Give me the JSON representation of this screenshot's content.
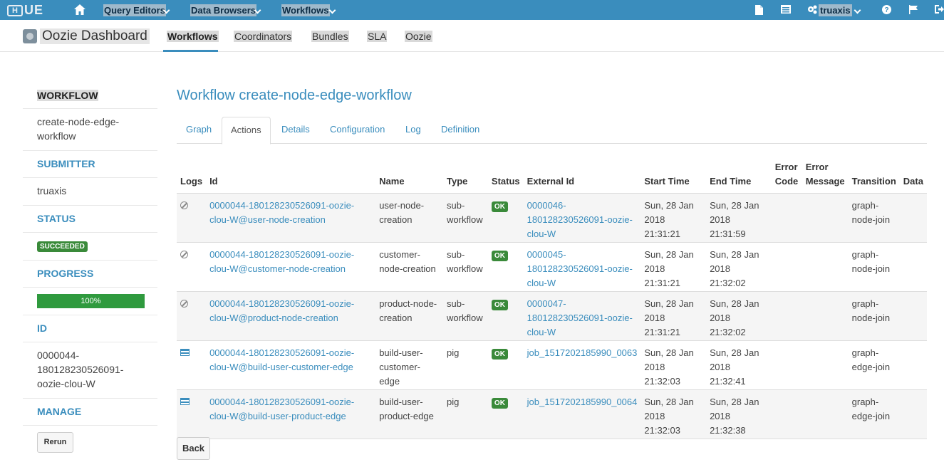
{
  "topbar": {
    "logo_text": "UE",
    "logo_letter": "H",
    "nav": [
      {
        "label": "Query Editors"
      },
      {
        "label": "Data Browsers"
      },
      {
        "label": "Workflows"
      }
    ],
    "user": "truaxis"
  },
  "subheader": {
    "app_title": "Oozie Dashboard",
    "tabs": [
      {
        "label": "Workflows",
        "active": true
      },
      {
        "label": "Coordinators"
      },
      {
        "label": "Bundles"
      },
      {
        "label": "SLA"
      },
      {
        "label": "Oozie"
      }
    ]
  },
  "sidebar": {
    "workflow_label": "WORKFLOW",
    "workflow_value": "create-node-edge-workflow",
    "submitter_label": "SUBMITTER",
    "submitter_value": "truaxis",
    "status_label": "STATUS",
    "status_value": "SUCCEEDED",
    "progress_label": "PROGRESS",
    "progress_value": "100%",
    "progress_fraction": 1.0,
    "id_label": "ID",
    "id_value": "0000044-180128230526091-oozie-clou-W",
    "manage_label": "MANAGE",
    "rerun_label": "Rerun"
  },
  "main": {
    "title": "Workflow create-node-edge-workflow",
    "tabs": [
      {
        "label": "Graph"
      },
      {
        "label": "Actions",
        "active": true
      },
      {
        "label": "Details"
      },
      {
        "label": "Configuration"
      },
      {
        "label": "Log"
      },
      {
        "label": "Definition"
      }
    ],
    "columns": [
      "Logs",
      "Id",
      "Name",
      "Type",
      "Status",
      "External Id",
      "Start Time",
      "End Time",
      "Error Code",
      "Error Message",
      "Transition",
      "Data"
    ],
    "rows": [
      {
        "log_icon": "ban-icon",
        "id": "0000044-180128230526091-oozie-clou-W@user-node-creation",
        "name": "user-node-creation",
        "type": "sub-workflow",
        "status": "OK",
        "external_id": "0000046-180128230526091-oozie-clou-W",
        "start_time": "Sun, 28 Jan 2018 21:31:21",
        "end_time": "Sun, 28 Jan 2018 21:31:59",
        "error_code": "",
        "error_message": "",
        "transition": "graph-node-join",
        "data": ""
      },
      {
        "log_icon": "ban-icon",
        "id": "0000044-180128230526091-oozie-clou-W@customer-node-creation",
        "name": "customer-node-creation",
        "type": "sub-workflow",
        "status": "OK",
        "external_id": "0000045-180128230526091-oozie-clou-W",
        "start_time": "Sun, 28 Jan 2018 21:31:21",
        "end_time": "Sun, 28 Jan 2018 21:32:02",
        "error_code": "",
        "error_message": "",
        "transition": "graph-node-join",
        "data": ""
      },
      {
        "log_icon": "ban-icon",
        "id": "0000044-180128230526091-oozie-clou-W@product-node-creation",
        "name": "product-node-creation",
        "type": "sub-workflow",
        "status": "OK",
        "external_id": "0000047-180128230526091-oozie-clou-W",
        "start_time": "Sun, 28 Jan 2018 21:31:21",
        "end_time": "Sun, 28 Jan 2018 21:32:02",
        "error_code": "",
        "error_message": "",
        "transition": "graph-node-join",
        "data": ""
      },
      {
        "log_icon": "log-icon",
        "id": "0000044-180128230526091-oozie-clou-W@build-user-customer-edge",
        "name": "build-user-customer-edge",
        "type": "pig",
        "status": "OK",
        "external_id": "job_1517202185990_0063",
        "start_time": "Sun, 28 Jan 2018 21:32:03",
        "end_time": "Sun, 28 Jan 2018 21:32:41",
        "error_code": "",
        "error_message": "",
        "transition": "graph-edge-join",
        "data": ""
      },
      {
        "log_icon": "log-icon",
        "id": "0000044-180128230526091-oozie-clou-W@build-user-product-edge",
        "name": "build-user-product-edge",
        "type": "pig",
        "status": "OK",
        "external_id": "job_1517202185990_0064",
        "start_time": "Sun, 28 Jan 2018 21:32:03",
        "end_time": "Sun, 28 Jan 2018 21:32:38",
        "error_code": "",
        "error_message": "",
        "transition": "graph-edge-join",
        "data": ""
      }
    ],
    "back_label": "Back"
  }
}
